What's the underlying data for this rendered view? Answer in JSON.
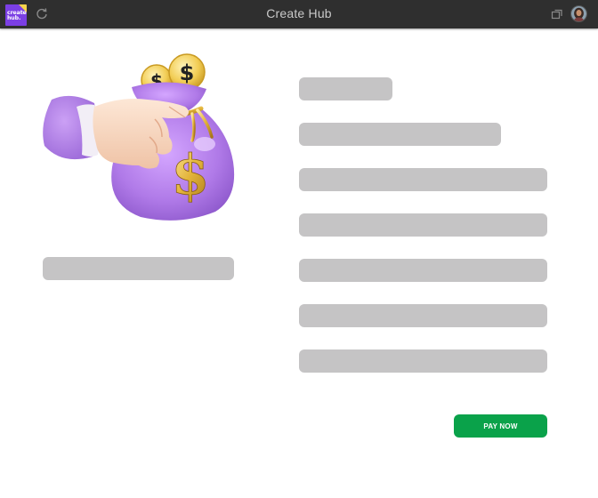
{
  "app": {
    "title": "Create Hub",
    "logo_text": "create\nhub.",
    "brand_color": "#7b3fe4",
    "accent_color": "#0aa24a"
  },
  "topbar": {
    "refresh_icon": "refresh-icon",
    "window_icon": "window-icon",
    "avatar_icon": "user-avatar"
  },
  "hero": {
    "icon": "money-bag-icon"
  },
  "placeholders": {
    "left": [
      "bar"
    ],
    "right": [
      "bar",
      "bar",
      "bar",
      "bar",
      "bar",
      "bar",
      "bar"
    ]
  },
  "actions": {
    "pay_label": "PAY NOW"
  }
}
